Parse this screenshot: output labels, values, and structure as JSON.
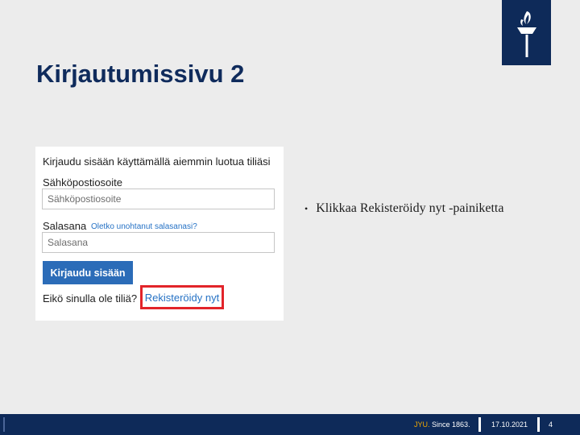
{
  "slide": {
    "title": "Kirjautumissivu 2"
  },
  "login_form": {
    "heading": "Kirjaudu sisään käyttämällä aiemmin luotua tiliäsi",
    "email_label": "Sähköpostiosoite",
    "email_placeholder": "Sähköpostiosoite",
    "password_label": "Salasana",
    "forgot_link": "Oletko unohtanut salasanasi?",
    "password_placeholder": "Salasana",
    "signin_button": "Kirjaudu sisään",
    "no_account_text": "Eikö sinulla ole tiliä?",
    "register_link": "Rekisteröidy nyt"
  },
  "bullets": [
    "Klikkaa Rekisteröidy nyt -painiketta"
  ],
  "footer": {
    "brand": "JYU.",
    "since": "Since 1863.",
    "date": "17.10.2021",
    "page": "4"
  },
  "colors": {
    "navy": "#0e2a59",
    "title": "#0f2b5c",
    "button": "#2b6cb8",
    "link": "#2672c5",
    "highlight": "#e2242a",
    "jyu_yellow": "#f2a900"
  }
}
